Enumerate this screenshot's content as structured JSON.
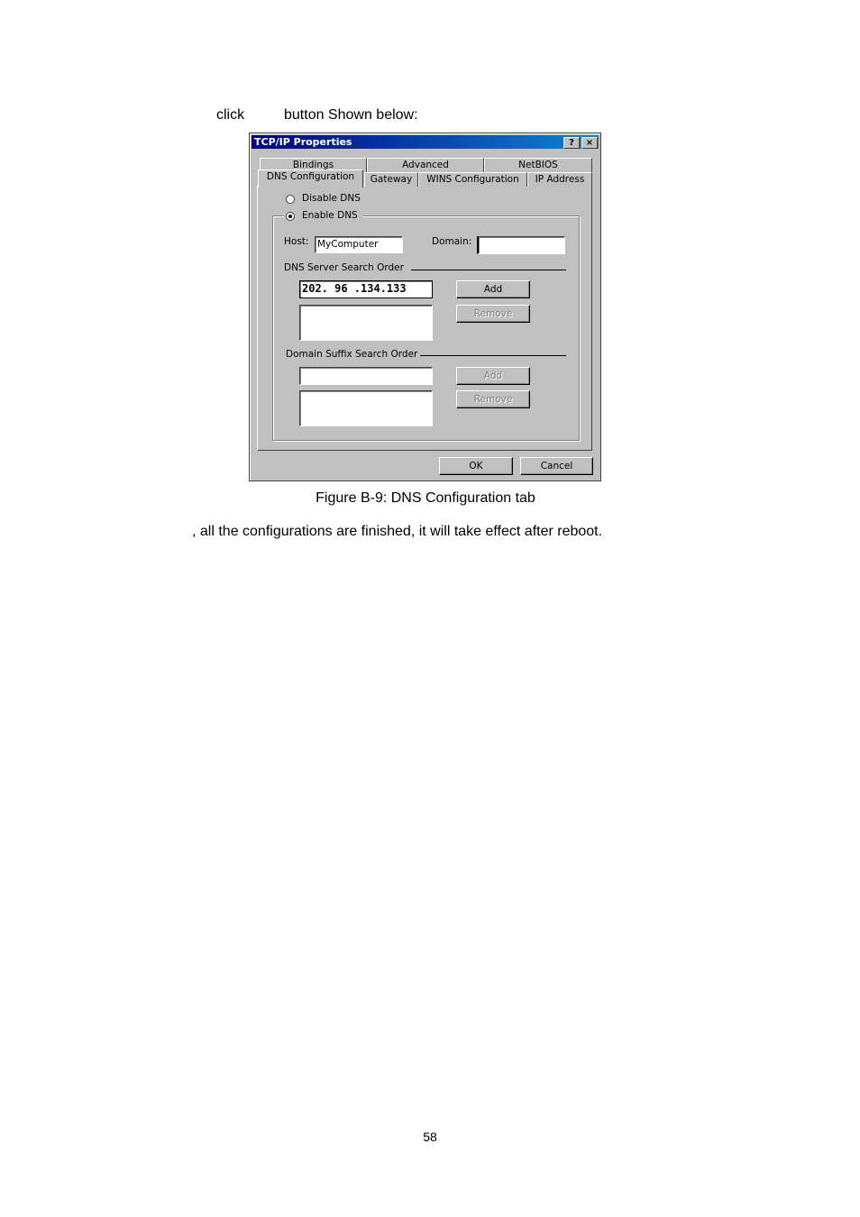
{
  "intro": {
    "click": "click",
    "rest": "button  Shown below:"
  },
  "dialog": {
    "title": "TCP/IP Properties",
    "help_label": "?",
    "close_label": "×",
    "tabs_back": [
      "Bindings",
      "Advanced",
      "NetBIOS"
    ],
    "tabs_front": [
      "DNS Configuration",
      "Gateway",
      "WINS Configuration",
      "IP Address"
    ],
    "active_tab": "DNS Configuration",
    "disable_dns": "Disable DNS",
    "enable_dns": "Enable DNS",
    "dns_enabled": true,
    "host_label": "Host:",
    "host_value": "MyComputer",
    "domain_label": "Domain:",
    "domain_value": "",
    "dns_server_label": "DNS Server Search Order",
    "dns_server_value": "202. 96 .134.133",
    "add_label": "Add",
    "remove_label": "Remove",
    "suffix_label": "Domain Suffix Search Order",
    "suffix_add_label": "Add",
    "suffix_remove_label": "Remove",
    "ok_label": "OK",
    "cancel_label": "Cancel"
  },
  "caption": "Figure B-9: DNS Configuration tab",
  "body_text": ", all the configurations are finished, it will take effect after reboot.",
  "page_number": "58"
}
